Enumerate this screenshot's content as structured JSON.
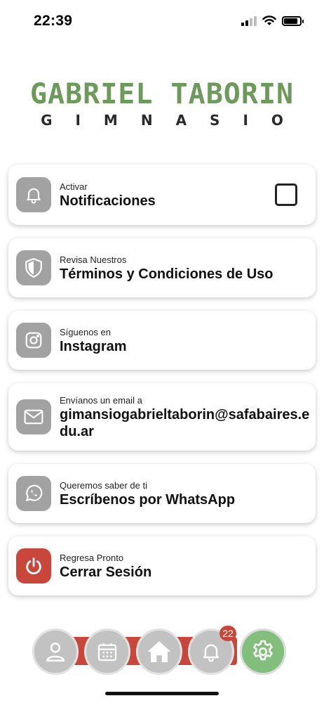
{
  "status_bar": {
    "time": "22:39"
  },
  "logo": {
    "title": "GABRIEL TABORIN",
    "subtitle": "GIMNASIO",
    "title_color": "#6c9a5a"
  },
  "cards": [
    {
      "small": "Activar",
      "big": "Notificaciones",
      "icon": "bell-icon",
      "checkbox_checked": false
    },
    {
      "small": "Revisa Nuestros",
      "big": "Términos y Condiciones de Uso",
      "icon": "shield-icon"
    },
    {
      "small": "Síguenos en",
      "big": "Instagram",
      "icon": "instagram-icon"
    },
    {
      "small": "Envíanos un email a",
      "big": "gimansiogabrieltaborin@safabaires.edu.ar",
      "icon": "mail-icon"
    },
    {
      "small": "Queremos saber de ti",
      "big": "Escríbenos por WhatsApp",
      "icon": "whatsapp-icon"
    },
    {
      "small": "Regresa Pronto",
      "big": "Cerrar Sesión",
      "icon": "power-icon",
      "icon_color": "#c9473a"
    }
  ],
  "bottom_nav": {
    "items": [
      "profile-icon",
      "calendar-icon",
      "home-icon",
      "bell-icon",
      "gear-icon"
    ],
    "active": "gear-icon",
    "notification_badge": "22",
    "accent_color": "#83bf7c"
  }
}
